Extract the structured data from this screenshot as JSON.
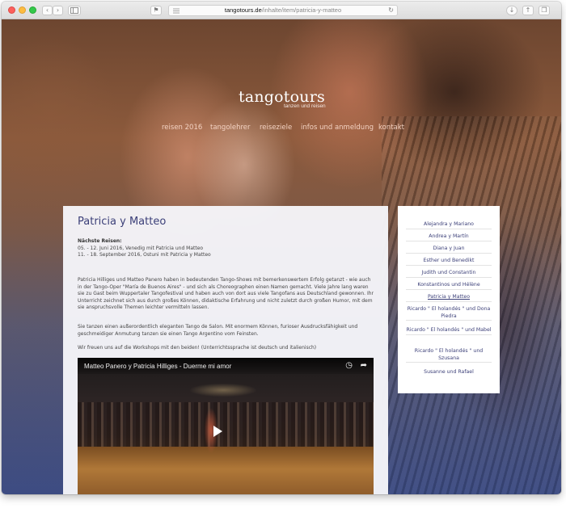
{
  "browser": {
    "url_domain": "tangotours.de",
    "url_path": "/inhalte/item/patricia-y-matteo",
    "icons": {
      "back": "chevron-left-icon",
      "forward": "chevron-right-icon",
      "sidebar": "sidebar-icon",
      "reader": "reader-icon",
      "reload": "reload-icon",
      "download": "download-icon",
      "share": "share-icon",
      "tabs": "tabs-icon"
    }
  },
  "site": {
    "logo_name": "tangotours",
    "logo_tagline": "tanzen und reisen",
    "nav": [
      "reisen 2016",
      "tangolehrer",
      "reiseziele",
      "infos und anmeldung",
      "kontakt"
    ]
  },
  "article": {
    "title": "Patricia y Matteo",
    "next_heading": "Nächste Reisen:",
    "next_items": [
      "05. - 12. Juni 2016, Venedig mit Patricia und Matteo",
      "11. - 18. September 2016, Ostuni mit Patricia y Matteo"
    ],
    "paragraphs": [
      "Patricia Hilliges und Matteo Panero haben in bedeutenden Tango-Shows mit bemerkenswertem Erfolg getanzt - wie auch in der Tango-Oper \"María de Buenos Aires\" - und sich als Choreographen einen Namen gemacht. Viele Jahre lang waren sie zu Gast beim Wuppertaler Tangofestival und haben auch von dort aus viele Tangofans aus Deutschland gewonnen. Ihr Unterricht zeichnet sich aus durch großes Können, didaktische Erfahrung und nicht zuletzt durch großen Humor, mit dem sie anspruchsvolle Themen leichter vermitteln lassen.",
      "Sie tanzen einen außerordentlich eleganten Tango de Salon. Mit enormem Können, furioser Ausdrucksfähigkeit und geschmeidiger Anmutung tanzen sie einen Tango Argentino vom Feinsten.",
      "Wir freuen uns auf die Workshops mit den beiden! (Unterrichtssprache ist deutsch und italienisch)"
    ],
    "video_title": "Matteo Panero y Patricia Hilliges - Duerme mi amor"
  },
  "sidebar": {
    "items": [
      "Alejandra y Mariano",
      "Andrea y Martín",
      "Diana y Juan",
      "Esther und Benedikt",
      "Judith und Constantin",
      "Konstantinos und Hélène",
      "Patricia y Matteo",
      "Ricardo \" El holandés \" und Dona Piedra",
      "Ricardo \" El holandés \" und Mabel",
      "Ricardo \" El holandés \" und Szusana",
      "Susanne und Rafael"
    ],
    "active_index": 6
  },
  "colors": {
    "accent": "#3b3f78",
    "nav_text": "#f3d2c2"
  }
}
